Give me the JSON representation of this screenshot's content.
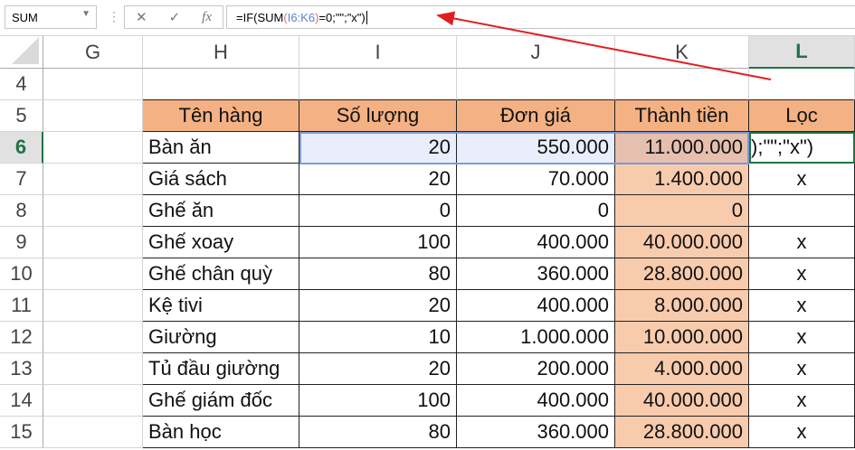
{
  "formula_bar": {
    "name_box": "SUM",
    "cancel_icon": "✕",
    "enter_icon": "✓",
    "fx_label": "fx",
    "formula_prefix": "=IF(SUM",
    "paren_open": "(",
    "ref": "I6:K6",
    "paren_close": ")",
    "formula_suffix": "=0;\"\";\"x\")"
  },
  "columns": [
    "G",
    "H",
    "I",
    "J",
    "K",
    "L"
  ],
  "rows": [
    "4",
    "5",
    "6",
    "7",
    "8",
    "9",
    "10",
    "11",
    "12",
    "13",
    "14",
    "15"
  ],
  "headers": [
    "Tên hàng",
    "Số lượng",
    "Đơn giá",
    "Thành tiền",
    "Lọc"
  ],
  "data": [
    [
      "Bàn ăn",
      "20",
      "550.000",
      "11.000.000",
      ");\"\";\"x\")"
    ],
    [
      "Giá sách",
      "20",
      "70.000",
      "1.400.000",
      "x"
    ],
    [
      "Ghế ăn",
      "0",
      "0",
      "0",
      ""
    ],
    [
      "Ghế xoay",
      "100",
      "400.000",
      "40.000.000",
      "x"
    ],
    [
      "Ghế chân quỳ",
      "80",
      "360.000",
      "28.800.000",
      "x"
    ],
    [
      "Kệ tivi",
      "20",
      "400.000",
      "8.000.000",
      "x"
    ],
    [
      "Giường",
      "10",
      "1.000.000",
      "10.000.000",
      "x"
    ],
    [
      "Tủ đầu giường",
      "20",
      "200.000",
      "4.000.000",
      "x"
    ],
    [
      "Ghế giám đốc",
      "100",
      "400.000",
      "40.000.000",
      "x"
    ],
    [
      "Bàn học",
      "80",
      "360.000",
      "28.800.000",
      "x"
    ]
  ],
  "colors": {
    "header_fill": "#f4b183",
    "total_fill": "#f8cbad",
    "arrow": "#e02020",
    "selection": "#217346"
  }
}
